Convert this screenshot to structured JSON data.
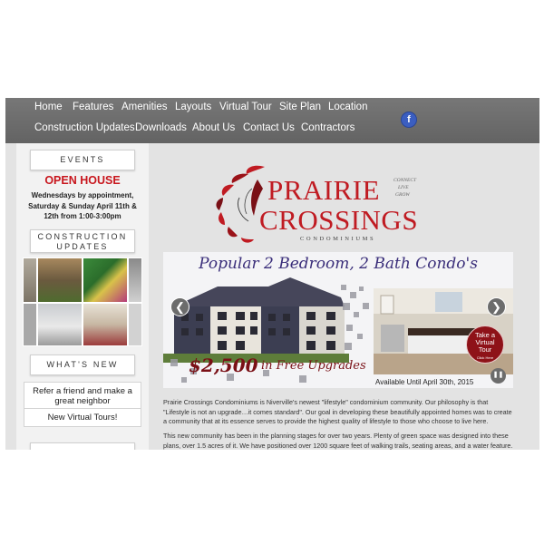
{
  "nav": {
    "items": [
      "Home",
      "Features",
      "Amenities",
      "Layouts",
      "Virtual Tour",
      "Site Plan",
      "Location",
      "Construction Updates",
      "Downloads",
      "About Us",
      "Contact Us",
      "Contractors"
    ],
    "facebook_icon": "facebook-icon",
    "facebook_glyph": "f"
  },
  "sidebar": {
    "events_heading": "EVENTS",
    "open_house_title": "OPEN HOUSE",
    "open_house_text": "Wednesdays by appointment, Saturday & Sunday April 11th & 12th from 1:00-3:00pm",
    "construction_heading_line1": "CONSTRUCTION",
    "construction_heading_line2": "UPDATES",
    "whats_new_heading": "WHAT'S NEW",
    "whats_new_items": [
      "Refer a friend and make a great neighbor",
      "New Virtual Tours!"
    ]
  },
  "logo": {
    "line1": "PRAIRIE",
    "line2": "CROSSINGS",
    "subtitle": "CONDOMINIUMS",
    "tag1": "CONNECT",
    "tag2": "LIVE",
    "tag3": "GROW"
  },
  "slider": {
    "title": "Popular 2 Bedroom, 2 Bath Condo's",
    "price": "$2,500",
    "price_suffix": "in Free Upgrades",
    "available_until": "Available Until April 30th, 2015",
    "tour_line1": "Take a",
    "tour_line2": "Virtual",
    "tour_line3": "Tour",
    "tour_small": "Click Here",
    "prev_glyph": "❮",
    "next_glyph": "❯",
    "pause_glyph": "❚❚"
  },
  "content": {
    "paragraph1": "Prairie Crossings Condominiums is Niverville's newest \"lifestyle\" condominium community. Our philosophy is that \"Lifestyle is not an upgrade…it comes standard\". Our goal in developing these beautifully appointed homes was to create a community that at its essence serves to provide the highest quality of lifestyle to those who choose to live here.",
    "paragraph2": "This new community has been in the planning stages for over two years. Plenty of green space was designed into these plans, over 1.5 acres of it. We have positioned over 1200 square feet of walking trails, seating areas, and a water feature. A"
  },
  "colors": {
    "brand_red": "#c01b22",
    "nav_bg": "#6b6b6b",
    "facebook_blue": "#3b5ec0"
  }
}
